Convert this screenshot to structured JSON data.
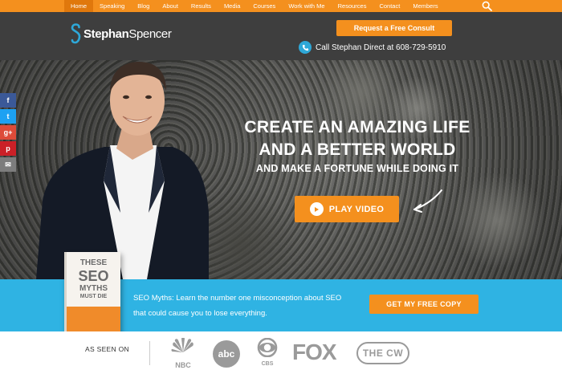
{
  "nav": {
    "items": [
      {
        "label": "Home",
        "active": true
      },
      {
        "label": "Speaking"
      },
      {
        "label": "Blog"
      },
      {
        "label": "About"
      },
      {
        "label": "Results"
      },
      {
        "label": "Media"
      },
      {
        "label": "Courses"
      },
      {
        "label": "Work with Me"
      },
      {
        "label": "Resources"
      },
      {
        "label": "Contact"
      },
      {
        "label": "Members"
      }
    ],
    "search_icon": "search-icon"
  },
  "header": {
    "logo_first": "Stephan",
    "logo_second": "Spencer",
    "consult_label": "Request a Free Consult",
    "phone_text": "Call Stephan Direct at 608-729-5910",
    "phone_icon": "phone-icon"
  },
  "hero": {
    "headline_line1": "CREATE AN AMAZING LIFE",
    "headline_line2": "AND A BETTER WORLD",
    "subheadline": "AND MAKE A FORTUNE WHILE DOING IT",
    "play_label": "PLAY VIDEO"
  },
  "share": {
    "facebook": "f",
    "twitter": "t",
    "googleplus": "g+",
    "pinterest": "p",
    "email": "✉"
  },
  "promo": {
    "text": "SEO Myths: Learn the number one misconception about SEO that could cause you to lose everything.",
    "button_label": "GET MY FREE COPY",
    "book_title_1": "THESE",
    "book_title_2": "SEO",
    "book_title_3": "MYTHS",
    "book_title_4": "MUST DIE"
  },
  "seen_on": {
    "label": "AS SEEN ON",
    "logos": [
      "NBC",
      "abc",
      "CBS",
      "FOX",
      "THE CW"
    ]
  },
  "colors": {
    "accent": "#f4901e",
    "nav_bg": "#f4901e",
    "header_bg": "#3e3e3e",
    "band_bg": "#2fb3e3"
  }
}
